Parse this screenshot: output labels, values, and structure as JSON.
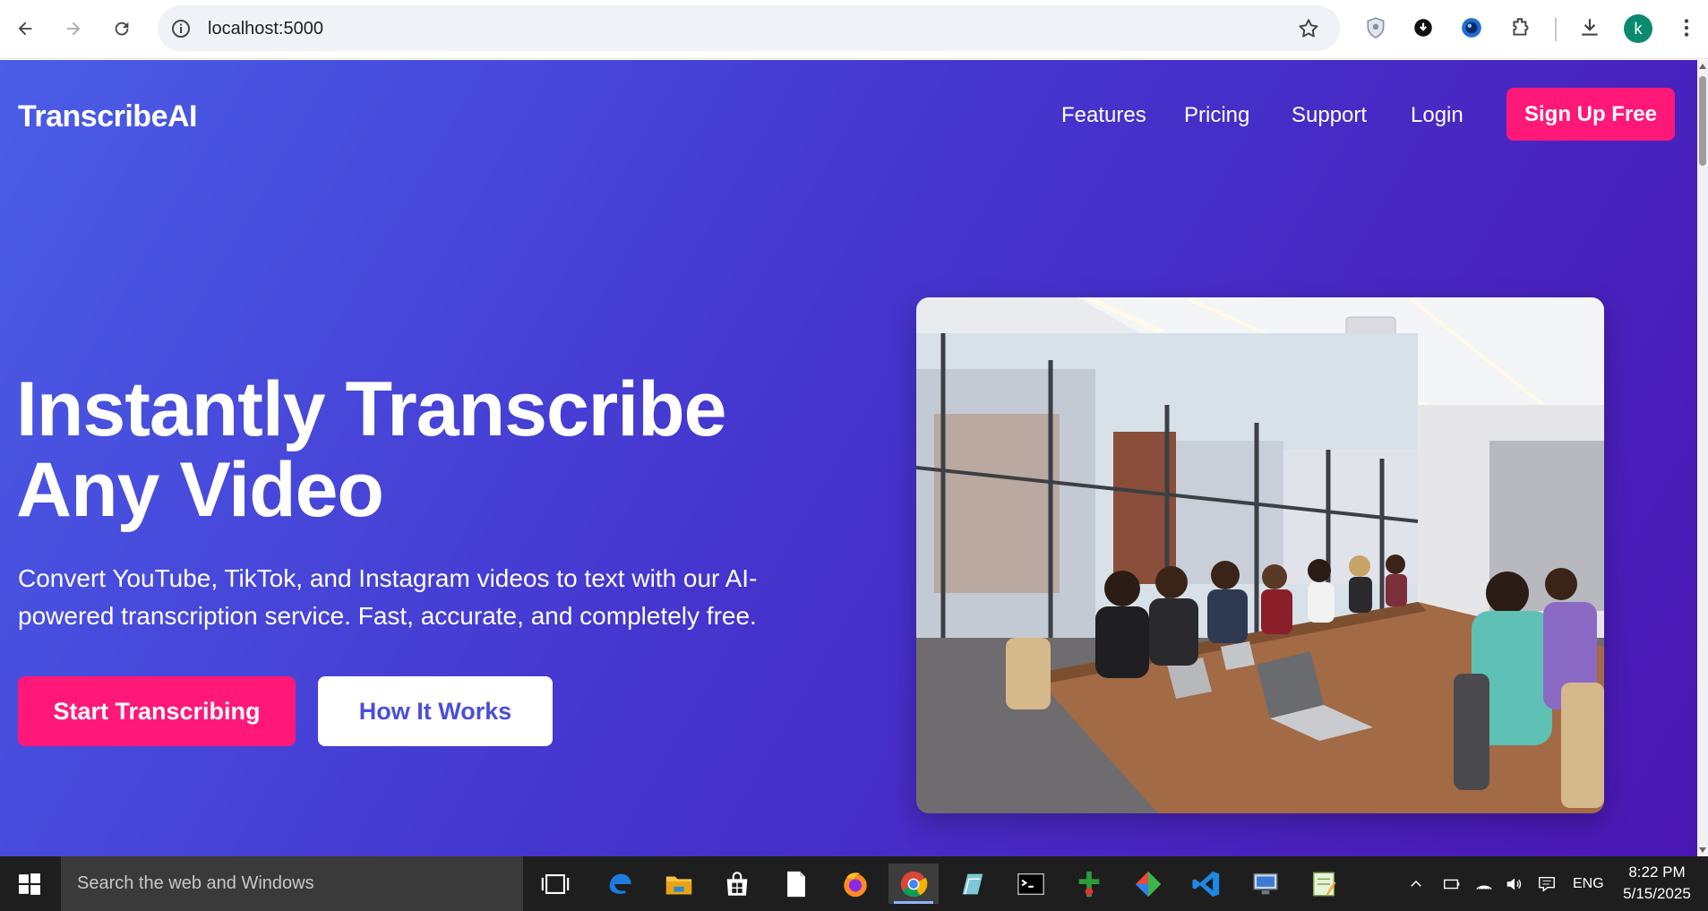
{
  "browser": {
    "url": "localhost:5000",
    "profile_initial": "k",
    "extensions": [
      "shield-extension-icon",
      "download-extension-icon",
      "blue-circle-extension-icon",
      "puzzle-extensions-icon"
    ]
  },
  "site": {
    "logo": "TranscribeAI",
    "nav": {
      "features": "Features",
      "pricing": "Pricing",
      "support": "Support",
      "login": "Login",
      "signup": "Sign Up Free"
    },
    "hero": {
      "title_line1": "Instantly Transcribe",
      "title_line2": "Any Video",
      "subtitle_line1": "Convert YouTube, TikTok, and Instagram videos to text with our AI-",
      "subtitle_line2": "powered transcription service. Fast, accurate, and completely free.",
      "primary_cta": "Start Transcribing",
      "secondary_cta": "How It Works"
    },
    "colors": {
      "accent_pink": "#ff1878",
      "gradient_start": "#4a5de6",
      "gradient_end": "#4a16b3",
      "secondary_text": "#4a4fd6"
    }
  },
  "taskbar": {
    "search_placeholder": "Search the web and Windows",
    "language": "ENG",
    "time": "8:22 PM",
    "date": "5/15/2025"
  }
}
